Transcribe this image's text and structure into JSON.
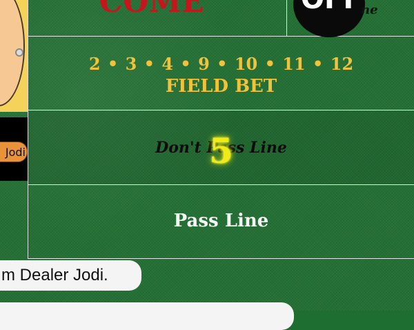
{
  "table": {
    "come_label": "COME",
    "puck_label": "OFF",
    "come_suffix": "ne",
    "field_numbers": "2 • 3 • 4 • 9 • 10 • 11 • 12",
    "field_label": "FIELD BET",
    "dont_pass_label": "Don't Pass Line",
    "point_number": "5",
    "pass_label": "Pass Line"
  },
  "dealer": {
    "name": "Jodi"
  },
  "chat": {
    "messages": [
      "m Dealer Jodi.",
      ""
    ]
  },
  "colors": {
    "felt": "#236f34",
    "come_text": "#c4161c",
    "field_text": "#f2c23a",
    "point_glow": "#f0ea1a",
    "puck": "#0a0a0a"
  }
}
